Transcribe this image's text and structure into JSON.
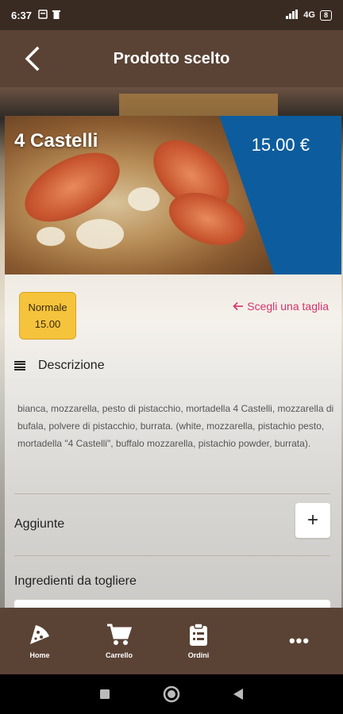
{
  "status": {
    "time": "6:37",
    "network": "4G",
    "battery": "8"
  },
  "appbar": {
    "title": "Prodotto scelto"
  },
  "product": {
    "name": "4 Castelli",
    "price": "15.00 €"
  },
  "size": {
    "label": "Normale",
    "price": "15.00",
    "hint": "Scegli una taglia"
  },
  "description": {
    "header": "Descrizione",
    "text": "bianca, mozzarella, pesto di pistacchio, mortadella 4 Castelli, mozzarella di bufala, polvere di pistacchio, burrata. (white, mozzarella, pistachio pesto, mortadella \"4 Castelli\", buffalo mozzarella, pistachio powder, burrata)."
  },
  "extras": {
    "add_label": "Aggiunte",
    "add_button": "+",
    "remove_label": "Ingredienti da togliere"
  },
  "nav": {
    "home": "Home",
    "cart": "Carrello",
    "orders": "Ordini",
    "more": "•••"
  },
  "colors": {
    "brown": "#5a4335",
    "blue": "#0d5d9e",
    "yellow": "#f6c33c",
    "pink": "#d6336c"
  }
}
